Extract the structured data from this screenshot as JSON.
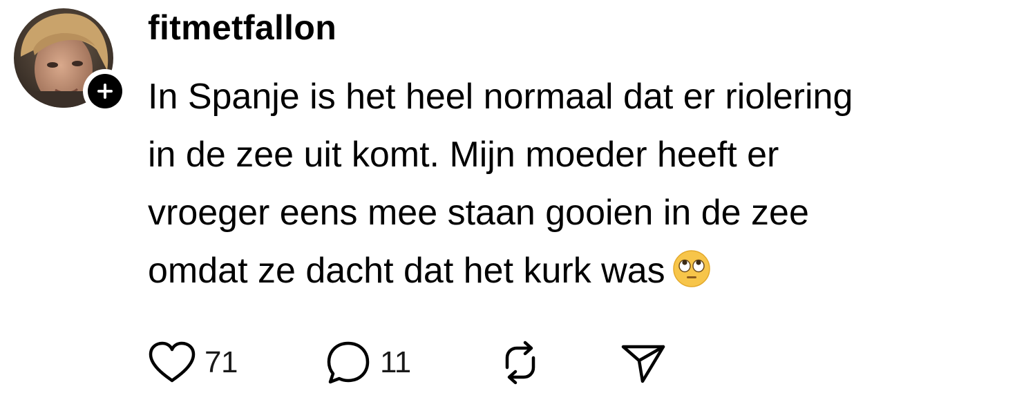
{
  "post": {
    "username": "fitmetfallon",
    "text": "In Spanje is het heel normaal dat er riolering\nin de zee uit komt. Mijn moeder heeft er\nvroeger eens mee staan gooien in de zee\nomdat ze dacht dat het kurk was",
    "emoji": "face-with-rolling-eyes"
  },
  "actions": {
    "like_count": "71",
    "reply_count": "11"
  },
  "icons": {
    "avatar": "avatar",
    "follow": "plus-icon",
    "like": "heart-icon",
    "reply": "comment-icon",
    "repost": "repost-icon",
    "share": "send-icon"
  }
}
